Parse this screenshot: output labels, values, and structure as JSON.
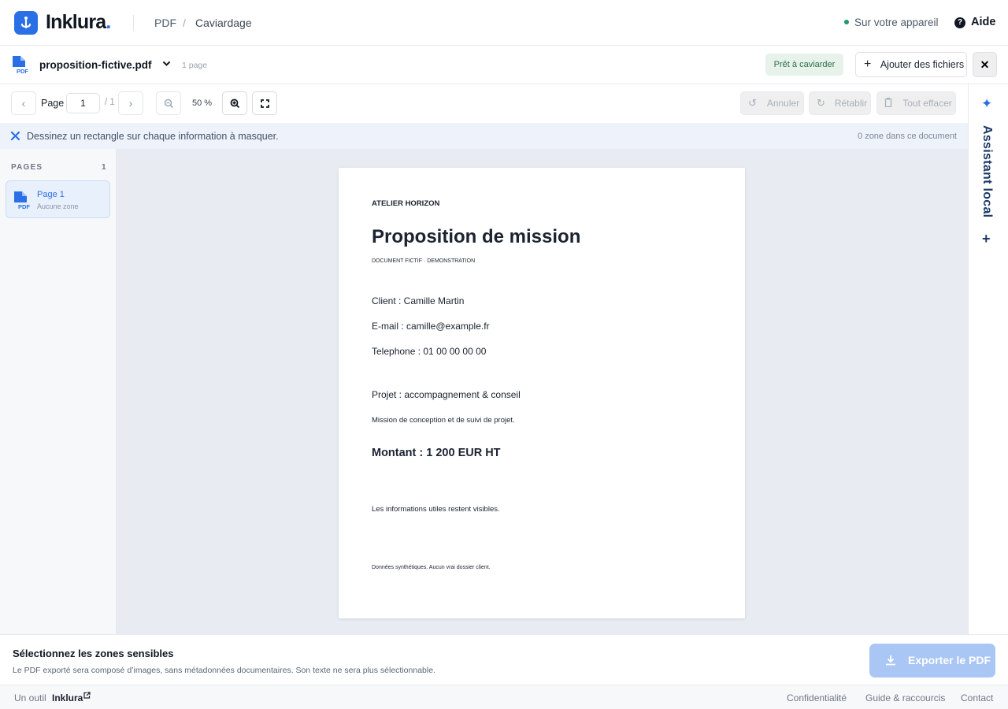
{
  "header": {
    "brand": "Inklura",
    "brand_dot": ".",
    "breadcrumb": [
      "PDF",
      "/",
      "Caviardage"
    ],
    "device_status": "Sur votre appareil",
    "help_label": "Aide"
  },
  "file": {
    "name": "proposition-fictive.pdf",
    "pages_label": "1 page",
    "status_badge": "Prêt à caviarder",
    "add_files_label": "Ajouter des fichiers"
  },
  "toolbar": {
    "page_label": "Page",
    "page_value": "1",
    "page_total": "/ 1",
    "zoom_level": "50 %",
    "undo_label": "Annuler",
    "redo_label": "Rétablir",
    "clear_label": "Tout effacer"
  },
  "hint": {
    "text": "Dessinez un rectangle sur chaque information à masquer.",
    "zone_count": "0 zone dans ce document"
  },
  "sidebar": {
    "heading": "PAGES",
    "count": "1",
    "pages": [
      {
        "title": "Page 1",
        "subtitle": "Aucune zone"
      }
    ]
  },
  "document": {
    "company": "ATELIER HORIZON",
    "title": "Proposition de mission",
    "subtitle": "DOCUMENT FICTIF · DEMONSTRATION",
    "client": "Client : Camille Martin",
    "email": "E-mail : camille@example.fr",
    "phone": "Telephone : 01 00 00 00 00",
    "project": "Projet : accompagnement & conseil",
    "mission": "Mission de conception et de suivi de projet.",
    "amount": "Montant : 1 200 EUR HT",
    "note": "Les informations utiles restent visibles.",
    "footer": "Données synthétiques. Aucun vrai dossier client."
  },
  "assistant": {
    "label": "Assistant local"
  },
  "export": {
    "title": "Sélectionnez les zones sensibles",
    "description": "Le PDF exporté sera composé d’images, sans métadonnées documentaires. Son texte ne sera plus sélectionnable.",
    "button_label": "Exporter le PDF"
  },
  "footer": {
    "tool_label": "Un outil",
    "brand": "Inklura",
    "links": [
      "Confidentialité",
      "Guide & raccourcis",
      "Contact"
    ]
  },
  "colors": {
    "accent": "#2b6fe6",
    "status_green": "#1d9a6c",
    "export_disabled": "#a9c6f5"
  }
}
